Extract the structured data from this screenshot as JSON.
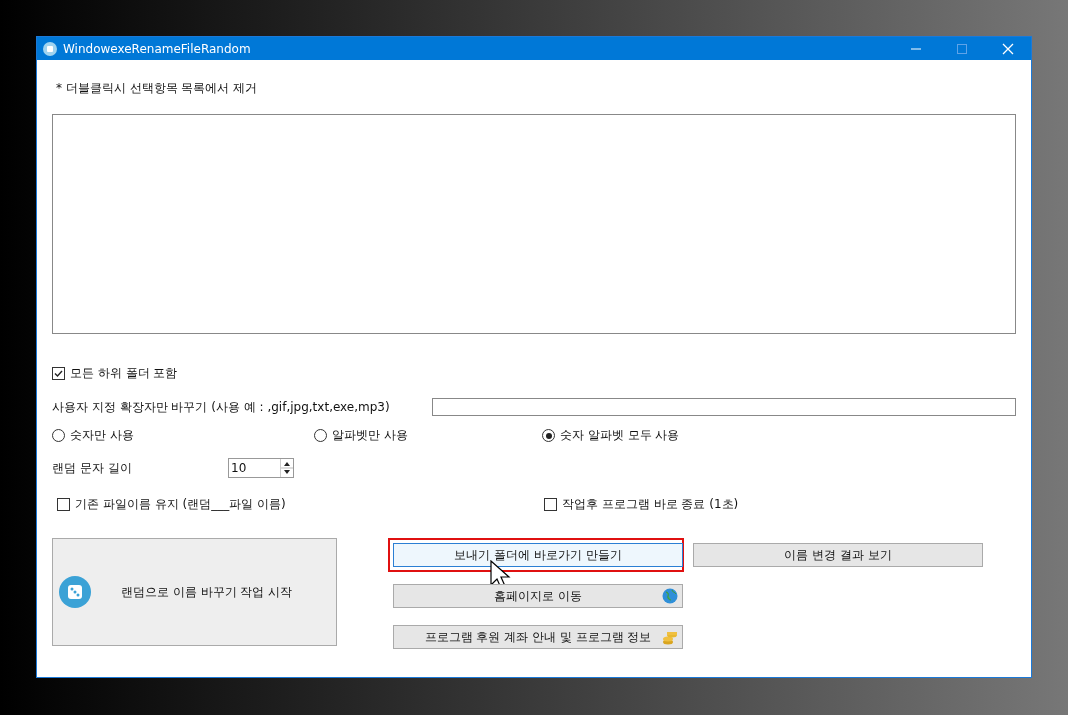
{
  "window": {
    "title": "WindowexeRenameFileRandom"
  },
  "hint": "* 더블클릭시 선택항목 목록에서 제거",
  "include_subfolders": {
    "label": "모든 하위 폴더 포함",
    "checked": true
  },
  "extension": {
    "label": "사용자 지정 확장자만 바꾸기 (사용 예 : ,gif,jpg,txt,exe,mp3)"
  },
  "modes": [
    {
      "label": "숫자만 사용",
      "selected": false
    },
    {
      "label": "알파벳만 사용",
      "selected": false
    },
    {
      "label": "숫자 알파벳 모두 사용",
      "selected": true
    }
  ],
  "length": {
    "label": "랜덤 문자 길이",
    "value": "10"
  },
  "options": [
    {
      "label": "기존 파일이름 유지 (랜덤___파일 이름)",
      "checked": false
    },
    {
      "label": "작업후 프로그램 바로 종료 (1초)",
      "checked": false
    }
  ],
  "start_button": "랜덤으로 이름 바꾸기 작업 시작",
  "buttons": [
    {
      "label": "보내기 폴더에 바로가기 만들기",
      "focused": true,
      "highlighted": true
    },
    {
      "label": "이름 변경 결과 보기",
      "focused": false,
      "highlighted": false
    },
    {
      "label": "홈페이지로 이동",
      "focused": false,
      "highlighted": false
    },
    {
      "label": "프로그램 후원 계좌 안내 및 프로그램 정보",
      "focused": false,
      "highlighted": false
    }
  ]
}
